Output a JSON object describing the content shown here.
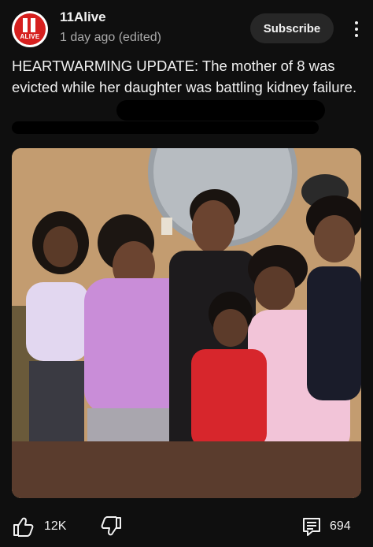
{
  "channel": {
    "name": "11Alive",
    "logo_text": "ALIVE",
    "post_time": "1 day ago (edited)"
  },
  "subscribe_label": "Subscribe",
  "post": {
    "text": "HEARTWARMING UPDATE: The mother of 8 was evicted while her daughter was battling kidney failure."
  },
  "image": {
    "icon": "family-photo"
  },
  "actions": {
    "like_count": "12K",
    "comment_count": "694"
  },
  "colors": {
    "background": "#0f0f0f",
    "text": "#f1f1f1",
    "secondary_text": "#aaaaaa",
    "brand_red": "#d6201f",
    "button_bg": "#272727"
  }
}
